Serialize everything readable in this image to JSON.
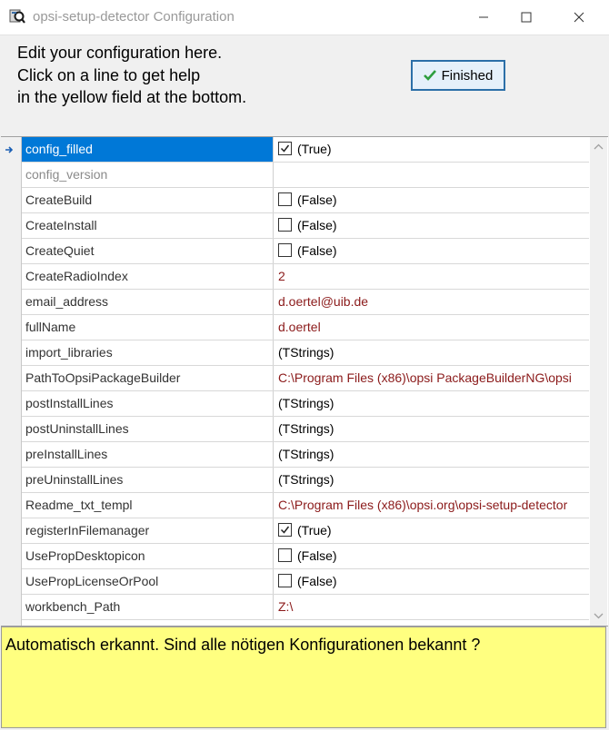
{
  "window": {
    "title": "opsi-setup-detector Configuration",
    "controls": [
      "minimize-icon",
      "maximize-icon",
      "close-icon"
    ]
  },
  "header": {
    "intro_text": "Edit your configuration here.\nClick on a line to get help\nin the yellow field at the bottom.",
    "finished_label": "Finished",
    "finished_icon": "checkmark-icon"
  },
  "grid": {
    "rows": [
      {
        "name": "config_filled",
        "value": "(True)",
        "kind": "checkbox",
        "checked": true
      },
      {
        "name": "config_version",
        "value": "",
        "kind": "text"
      },
      {
        "name": "CreateBuild",
        "value": "(False)",
        "kind": "checkbox",
        "checked": false
      },
      {
        "name": "CreateInstall",
        "value": "(False)",
        "kind": "checkbox",
        "checked": false
      },
      {
        "name": "CreateQuiet",
        "value": "(False)",
        "kind": "checkbox",
        "checked": false
      },
      {
        "name": "CreateRadioIndex",
        "value": "2",
        "kind": "text",
        "color": "red"
      },
      {
        "name": "email_address",
        "value": "d.oertel@uib.de",
        "kind": "text",
        "color": "red"
      },
      {
        "name": "fullName",
        "value": "d.oertel",
        "kind": "text",
        "color": "red"
      },
      {
        "name": "import_libraries",
        "value": "(TStrings)",
        "kind": "text"
      },
      {
        "name": "PathToOpsiPackageBuilder",
        "value": "C:\\Program Files (x86)\\opsi PackageBuilderNG\\opsi",
        "kind": "text",
        "color": "red"
      },
      {
        "name": "postInstallLines",
        "value": "(TStrings)",
        "kind": "text"
      },
      {
        "name": "postUninstallLines",
        "value": "(TStrings)",
        "kind": "text"
      },
      {
        "name": "preInstallLines",
        "value": "(TStrings)",
        "kind": "text"
      },
      {
        "name": "preUninstallLines",
        "value": "(TStrings)",
        "kind": "text"
      },
      {
        "name": "Readme_txt_templ",
        "value": "C:\\Program Files (x86)\\opsi.org\\opsi-setup-detector",
        "kind": "text",
        "color": "red"
      },
      {
        "name": "registerInFilemanager",
        "value": "(True)",
        "kind": "checkbox",
        "checked": true
      },
      {
        "name": "UsePropDesktopicon",
        "value": "(False)",
        "kind": "checkbox",
        "checked": false
      },
      {
        "name": "UsePropLicenseOrPool",
        "value": "(False)",
        "kind": "checkbox",
        "checked": false
      },
      {
        "name": "workbench_Path",
        "value": "Z:\\",
        "kind": "text",
        "color": "red"
      }
    ],
    "selected_row": "config_filled",
    "disabled_rows": [
      "config_version"
    ]
  },
  "help": {
    "text": "Automatisch erkannt. Sind alle nötigen Konfigurationen bekannt ?"
  },
  "colors": {
    "selected_row_bg": "#0078d7",
    "value_red": "#8b1a1a",
    "help_bg": "#ffff80",
    "button_border": "#2b6fa8"
  }
}
